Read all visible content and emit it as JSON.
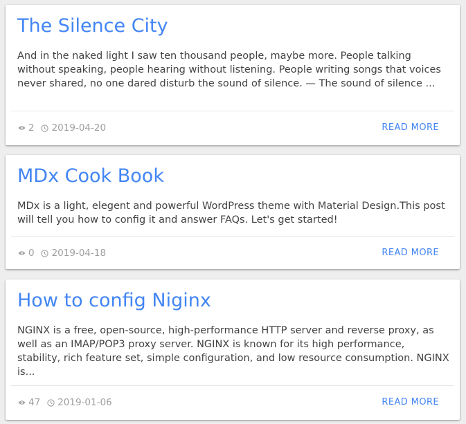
{
  "colors": {
    "accent": "#4285f4",
    "text": "#424242",
    "meta": "#9e9e9e",
    "background": "#eeeeee",
    "card": "#ffffff"
  },
  "posts": [
    {
      "title": "The Silence City",
      "excerpt": "And in the naked light I saw ten thousand people, maybe more. People talking without speaking, people hearing without listening. People writing songs that voices never shared, no one dared disturb the sound of silence. — The sound of silence ...",
      "views": "2",
      "date": "2019-04-20",
      "read_more": "READ MORE",
      "views_icon": "eye-icon",
      "date_icon": "clock-icon"
    },
    {
      "title": "MDx Cook Book",
      "excerpt": "MDx is a light, elegent and powerful WordPress theme with Material Design.This post will tell you how to config it and answer FAQs. Let's get started!",
      "views": "0",
      "date": "2019-04-18",
      "read_more": "READ MORE",
      "views_icon": "eye-icon",
      "date_icon": "clock-icon"
    },
    {
      "title": "How to config Niginx",
      "excerpt": "NGINX is a free, open-source, high-performance HTTP server and reverse proxy, as well as an IMAP/POP3 proxy server. NGINX is known for its high performance, stability, rich feature set, simple configuration, and low resource consumption. NGINX is...",
      "views": "47",
      "date": "2019-01-06",
      "read_more": "READ MORE",
      "views_icon": "eye-icon",
      "date_icon": "clock-icon"
    }
  ]
}
